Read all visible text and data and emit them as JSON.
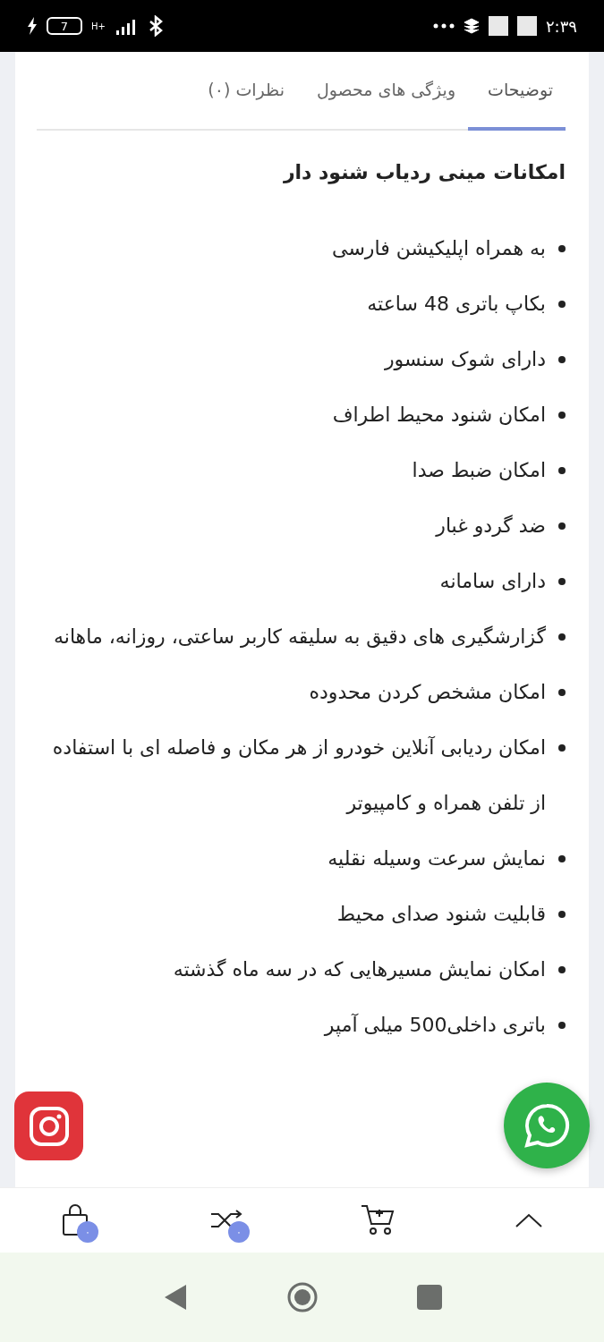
{
  "status_bar": {
    "time": "۲:۳۹",
    "battery": "7",
    "network": "H+"
  },
  "tabs": [
    {
      "label": "توضیحات",
      "selected": true
    },
    {
      "label": "ویژگی های محصول",
      "selected": false
    },
    {
      "label": "نظرات (۰)",
      "selected": false
    }
  ],
  "heading": "امکانات مینی ردیاب شنود دار",
  "features": [
    "به همراه اپلیکیشن فارسی",
    "بکاپ باتری 48 ساعته",
    "دارای شوک سنسور",
    "امکان شنود محیط اطراف",
    "امکان ضبط صدا",
    "ضد گردو غبار",
    "دارای سامانه",
    "گزارشگیری های دقیق به سلیقه کاربر ساعتی، روزانه، ماهانه",
    "امکان مشخص کردن محدوده",
    "امکان ردیابی آنلاین خودرو از هر مکان و فاصله ای با استفاده از تلفن همراه و کامپیوتر",
    "نمایش سرعت وسیله نقلیه",
    "قابلیت شنود صدای محیط",
    "امکان نمایش مسیرهایی که در سه ماه گذشته",
    "باتری داخلی500 میلی آمپر"
  ],
  "bottom_bar": [
    {
      "kind": "top"
    },
    {
      "kind": "cart"
    },
    {
      "kind": "compare",
      "badge": "۰"
    },
    {
      "kind": "bag",
      "badge": "۰"
    }
  ]
}
